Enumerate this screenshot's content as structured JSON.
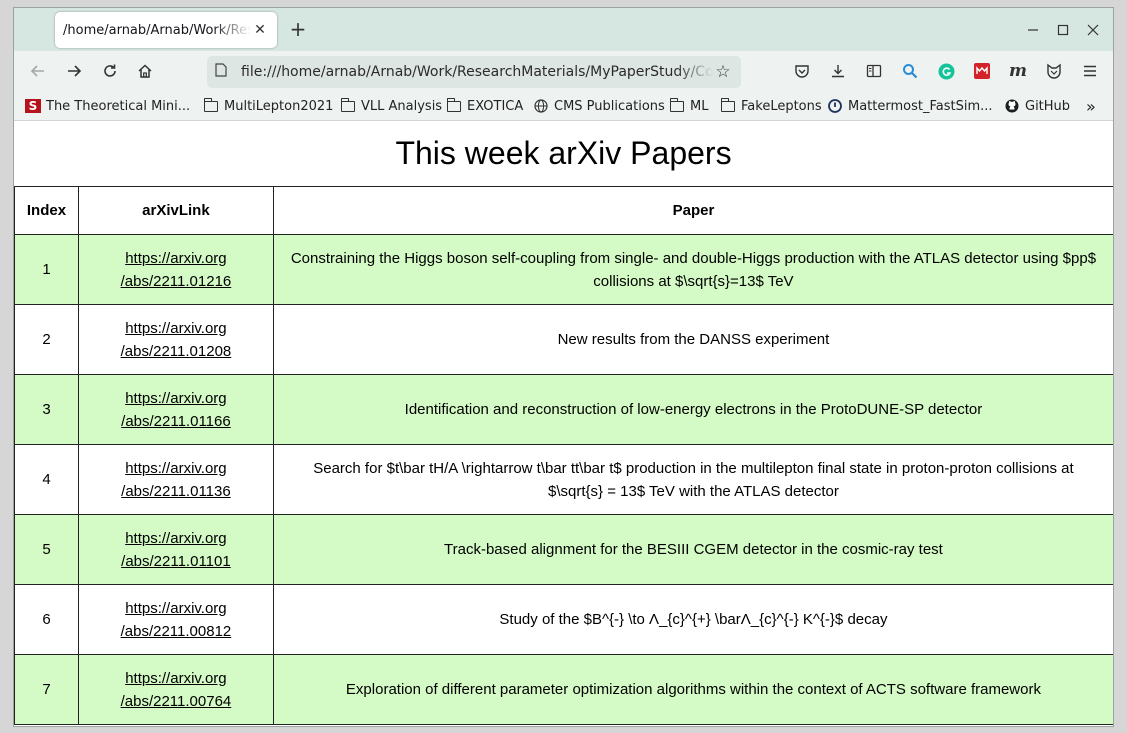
{
  "tab": {
    "title": "/home/arnab/Arnab/Work/ResearchMaterials/MyPaperStudy/CodeForArxiv/index.html"
  },
  "url": "file:///home/arnab/Arnab/Work/ResearchMaterials/MyPaperStudy/CodeForArxiv/index.html",
  "bookmarks": [
    {
      "label": "The Theoretical Mini...",
      "icon": "theoretical-minimum-icon"
    },
    {
      "label": "MultiLepton2021",
      "icon": "folder-icon"
    },
    {
      "label": "VLL Analysis",
      "icon": "folder-icon"
    },
    {
      "label": "EXOTICA",
      "icon": "folder-icon"
    },
    {
      "label": "CMS Publications",
      "icon": "globe-icon"
    },
    {
      "label": "ML",
      "icon": "folder-icon"
    },
    {
      "label": "FakeLeptons",
      "icon": "folder-icon"
    },
    {
      "label": "Mattermost_FastSim...",
      "icon": "mattermost-icon"
    },
    {
      "label": "GitHub",
      "icon": "github-icon"
    }
  ],
  "page": {
    "title": "This week arXiv Papers",
    "headers": [
      "Index",
      "arXivLink",
      "Paper"
    ],
    "rows": [
      {
        "index": "1",
        "link_line1": "https://arxiv.org",
        "link_line2": "/abs/2211.01216",
        "paper": "Constraining the Higgs boson self-coupling from single- and double-Higgs production with the ATLAS detector using $pp$ collisions at $\\sqrt{s}=13$ TeV"
      },
      {
        "index": "2",
        "link_line1": "https://arxiv.org",
        "link_line2": "/abs/2211.01208",
        "paper": "New results from the DANSS experiment"
      },
      {
        "index": "3",
        "link_line1": "https://arxiv.org",
        "link_line2": "/abs/2211.01166",
        "paper": "Identification and reconstruction of low-energy electrons in the ProtoDUNE-SP detector"
      },
      {
        "index": "4",
        "link_line1": "https://arxiv.org",
        "link_line2": "/abs/2211.01136",
        "paper": "Search for $t\\bar tH/A \\rightarrow t\\bar tt\\bar t$ production in the multilepton final state in proton-proton collisions at $\\sqrt{s} = 13$ TeV with the ATLAS detector"
      },
      {
        "index": "5",
        "link_line1": "https://arxiv.org",
        "link_line2": "/abs/2211.01101",
        "paper": "Track-based alignment for the BESIII CGEM detector in the cosmic-ray test"
      },
      {
        "index": "6",
        "link_line1": "https://arxiv.org",
        "link_line2": "/abs/2211.00812",
        "paper": "Study of the $B^{-} \\to Λ_{c}^{+} \\barΛ_{c}^{-} K^{-}$ decay"
      },
      {
        "index": "7",
        "link_line1": "https://arxiv.org",
        "link_line2": "/abs/2211.00764",
        "paper": "Exploration of different parameter optimization algorithms within the context of ACTS software framework"
      }
    ]
  },
  "colors": {
    "row_green": "#d4fac5",
    "tabbar": "#d6e6e0",
    "toolbar": "#eef2f1"
  }
}
